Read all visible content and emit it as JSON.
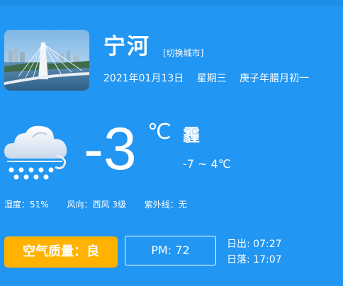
{
  "city": {
    "name": "宁河",
    "switch_label": "[切换城市]",
    "photo": "city-bridge-photo"
  },
  "date": {
    "date": "2021年01月13日",
    "weekday": "星期三",
    "lunar": "庚子年腊月初一"
  },
  "weather": {
    "icon": "snow-cloud-icon",
    "temperature": "-3",
    "unit": "℃",
    "condition": "霾",
    "range": "-7 ~ 4℃"
  },
  "details": {
    "humidity": "湿度：51%",
    "wind": "风向：西风 3级",
    "uv": "紫外线：无"
  },
  "air": {
    "quality_label": "空气质量：良",
    "pm": "PM: 72"
  },
  "sun": {
    "sunrise": "日出: 07:27",
    "sunset": "日落: 17:07"
  },
  "colors": {
    "background": "#2196f3",
    "aqi_button": "#ffb300",
    "text": "#ffffff"
  }
}
